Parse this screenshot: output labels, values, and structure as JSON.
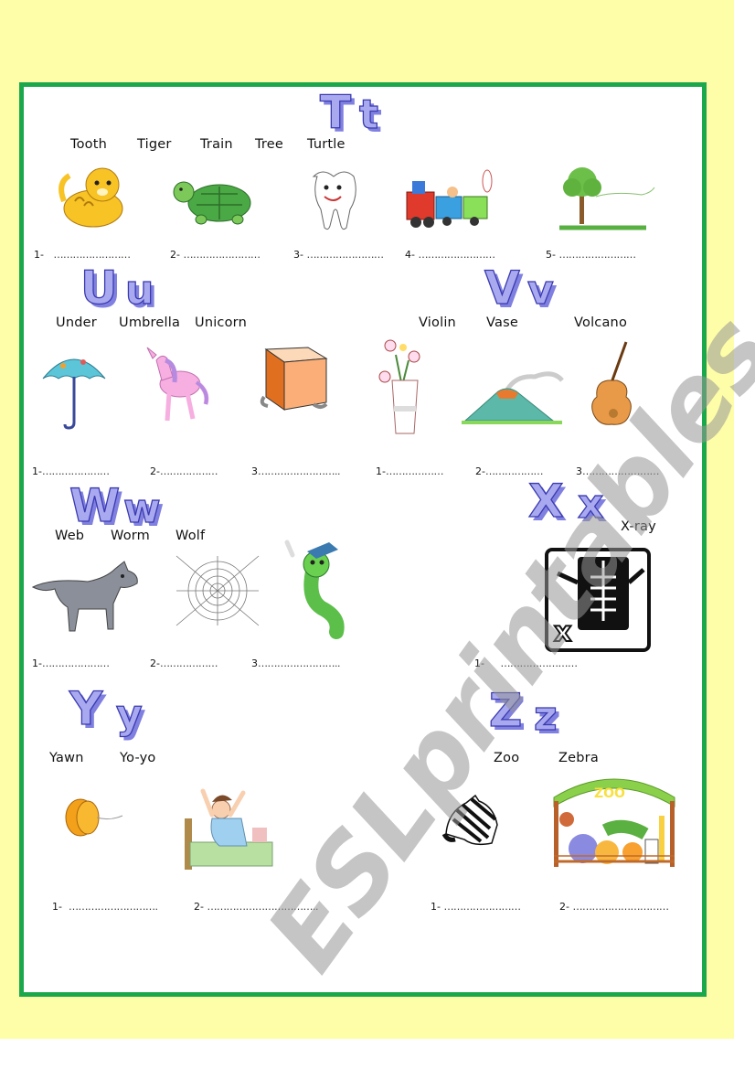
{
  "colors": {
    "page_background": "#fefea8",
    "frame_border": "#1ba84c",
    "letter_fill": "#a9a9f0",
    "letter_outline": "#3a3ab0",
    "watermark": "#969696"
  },
  "watermark": "ESLprintables.com",
  "sections": {
    "t": {
      "letters": {
        "upper": "T",
        "lower": "t"
      },
      "words": [
        "Tooth",
        "Tiger",
        "Train",
        "Tree",
        "Turtle"
      ],
      "pictures": [
        "tiger-picture",
        "turtle-picture",
        "tooth-picture",
        "train-picture",
        "tree-picture"
      ],
      "blanks": [
        {
          "label": "1-",
          "dots": "……………………"
        },
        {
          "label": "2-",
          "dots": "……………………"
        },
        {
          "label": "3-",
          "dots": "……………………"
        },
        {
          "label": "4-",
          "dots": "……………………"
        },
        {
          "label": "5-",
          "dots": "……………………"
        }
      ]
    },
    "u": {
      "letters": {
        "upper": "U",
        "lower": "u"
      },
      "words": [
        "Under",
        "Umbrella",
        "Unicorn"
      ],
      "pictures": [
        "umbrella-picture",
        "unicorn-picture",
        "box-picture"
      ],
      "blanks": [
        {
          "label": "1-",
          "dots": "…………………"
        },
        {
          "label": "2-",
          "dots": "………………"
        },
        {
          "label": "3",
          "dots": "…………………….."
        }
      ]
    },
    "v": {
      "letters": {
        "upper": "V",
        "lower": "v"
      },
      "words": [
        "Violin",
        "Vase",
        "Volcano"
      ],
      "pictures": [
        "vase-picture",
        "volcano-picture",
        "violin-picture"
      ],
      "blanks": [
        {
          "label": "1-",
          "dots": "………………"
        },
        {
          "label": "2-",
          "dots": "………………"
        },
        {
          "label": "3",
          "dots": "……………………"
        }
      ]
    },
    "w": {
      "letters": {
        "upper": "W",
        "lower": "w"
      },
      "words": [
        "Web",
        "Worm",
        "Wolf"
      ],
      "pictures": [
        "wolf-picture",
        "web-picture",
        "worm-picture"
      ],
      "blanks": [
        {
          "label": "1-",
          "dots": "…………………"
        },
        {
          "label": "2-",
          "dots": "………………"
        },
        {
          "label": "3",
          "dots": "…………………….."
        }
      ]
    },
    "x": {
      "letters": {
        "upper": "X",
        "lower": "x"
      },
      "words": [
        "X-ray"
      ],
      "pictures": [
        "x-ray-picture"
      ],
      "blanks": [
        {
          "label": "1-",
          "dots": "……………………"
        }
      ]
    },
    "y": {
      "letters": {
        "upper": "Y",
        "lower": "y"
      },
      "words": [
        "Yawn",
        "Yo-yo"
      ],
      "pictures": [
        "yo-yo-picture",
        "yawn-picture"
      ],
      "blanks": [
        {
          "label": "1-",
          "dots": "………………………."
        },
        {
          "label": "2-",
          "dots": "…………………………….."
        }
      ]
    },
    "z": {
      "letters": {
        "upper": "Z",
        "lower": "z"
      },
      "words": [
        "Zoo",
        "Zebra"
      ],
      "pictures": [
        "zebra-picture",
        "zoo-picture"
      ],
      "blanks": [
        {
          "label": "1-",
          "dots": "……………………"
        },
        {
          "label": "2-",
          "dots": "…………………………"
        }
      ]
    },
    "zoo_sign": "ZOO"
  }
}
